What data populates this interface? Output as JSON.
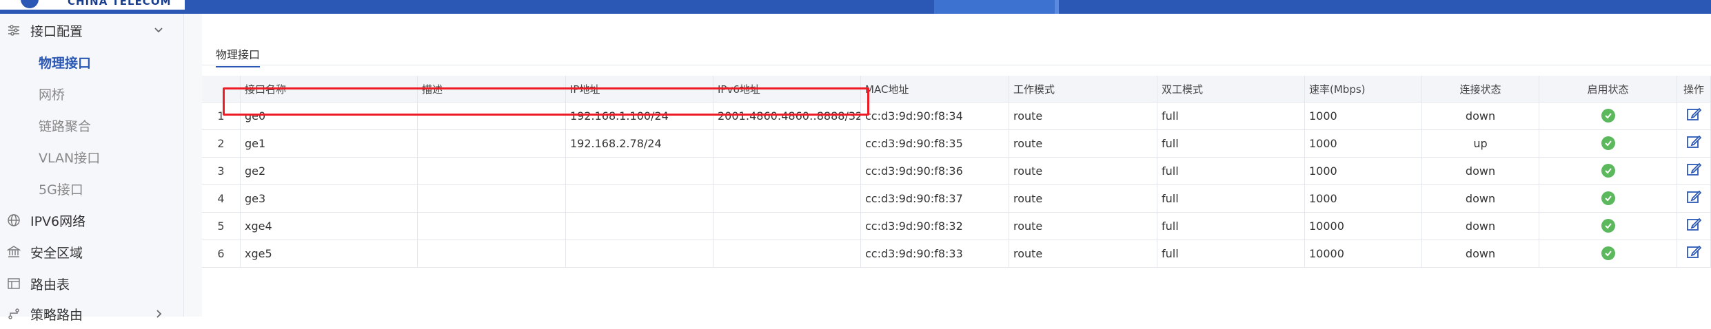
{
  "brand": {
    "text": "CHINA TELECOM"
  },
  "sidebar": {
    "group": {
      "label": "接口配置",
      "icon": "sliders-icon"
    },
    "sub_items": [
      {
        "label": "物理接口",
        "active": true
      },
      {
        "label": "网桥"
      },
      {
        "label": "链路聚合"
      },
      {
        "label": "VLAN接口"
      },
      {
        "label": "5G接口"
      }
    ],
    "items": [
      {
        "label": "IPV6网络",
        "icon": "globe-icon"
      },
      {
        "label": "安全区域",
        "icon": "bank-icon"
      },
      {
        "label": "路由表",
        "icon": "table-icon"
      },
      {
        "label": "策略路由",
        "icon": "route-icon"
      }
    ]
  },
  "tabs": [
    {
      "label": "物理接口"
    }
  ],
  "table": {
    "columns": [
      "",
      "接口名称",
      "描述",
      "IP地址",
      "IPv6地址",
      "MAC地址",
      "工作模式",
      "双工模式",
      "速率(Mbps)",
      "连接状态",
      "启用状态",
      "操作"
    ],
    "rows": [
      {
        "index": "1",
        "name": "ge0",
        "desc": "",
        "ip": "192.168.1.100/24",
        "ipv6": "2001:4860:4860::8888/32",
        "mac": "cc:d3:9d:90:f8:34",
        "mode": "route",
        "duplex": "full",
        "speed": "1000",
        "link": "down",
        "enabled": "check-circle-icon"
      },
      {
        "index": "2",
        "name": "ge1",
        "desc": "",
        "ip": "192.168.2.78/24",
        "ipv6": "",
        "mac": "cc:d3:9d:90:f8:35",
        "mode": "route",
        "duplex": "full",
        "speed": "1000",
        "link": "up",
        "enabled": "check-circle-icon"
      },
      {
        "index": "3",
        "name": "ge2",
        "desc": "",
        "ip": "",
        "ipv6": "",
        "mac": "cc:d3:9d:90:f8:36",
        "mode": "route",
        "duplex": "full",
        "speed": "1000",
        "link": "down",
        "enabled": "check-circle-icon"
      },
      {
        "index": "4",
        "name": "ge3",
        "desc": "",
        "ip": "",
        "ipv6": "",
        "mac": "cc:d3:9d:90:f8:37",
        "mode": "route",
        "duplex": "full",
        "speed": "1000",
        "link": "down",
        "enabled": "check-circle-icon"
      },
      {
        "index": "5",
        "name": "xge4",
        "desc": "",
        "ip": "",
        "ipv6": "",
        "mac": "cc:d3:9d:90:f8:32",
        "mode": "route",
        "duplex": "full",
        "speed": "10000",
        "link": "down",
        "enabled": "check-circle-icon"
      },
      {
        "index": "6",
        "name": "xge5",
        "desc": "",
        "ip": "",
        "ipv6": "",
        "mac": "cc:d3:9d:90:f8:33",
        "mode": "route",
        "duplex": "full",
        "speed": "10000",
        "link": "down",
        "enabled": "check-circle-icon"
      }
    ]
  },
  "colors": {
    "accent": "#2b58b5",
    "enabled": "#5cb85c",
    "highlight": "#ee1b24"
  }
}
